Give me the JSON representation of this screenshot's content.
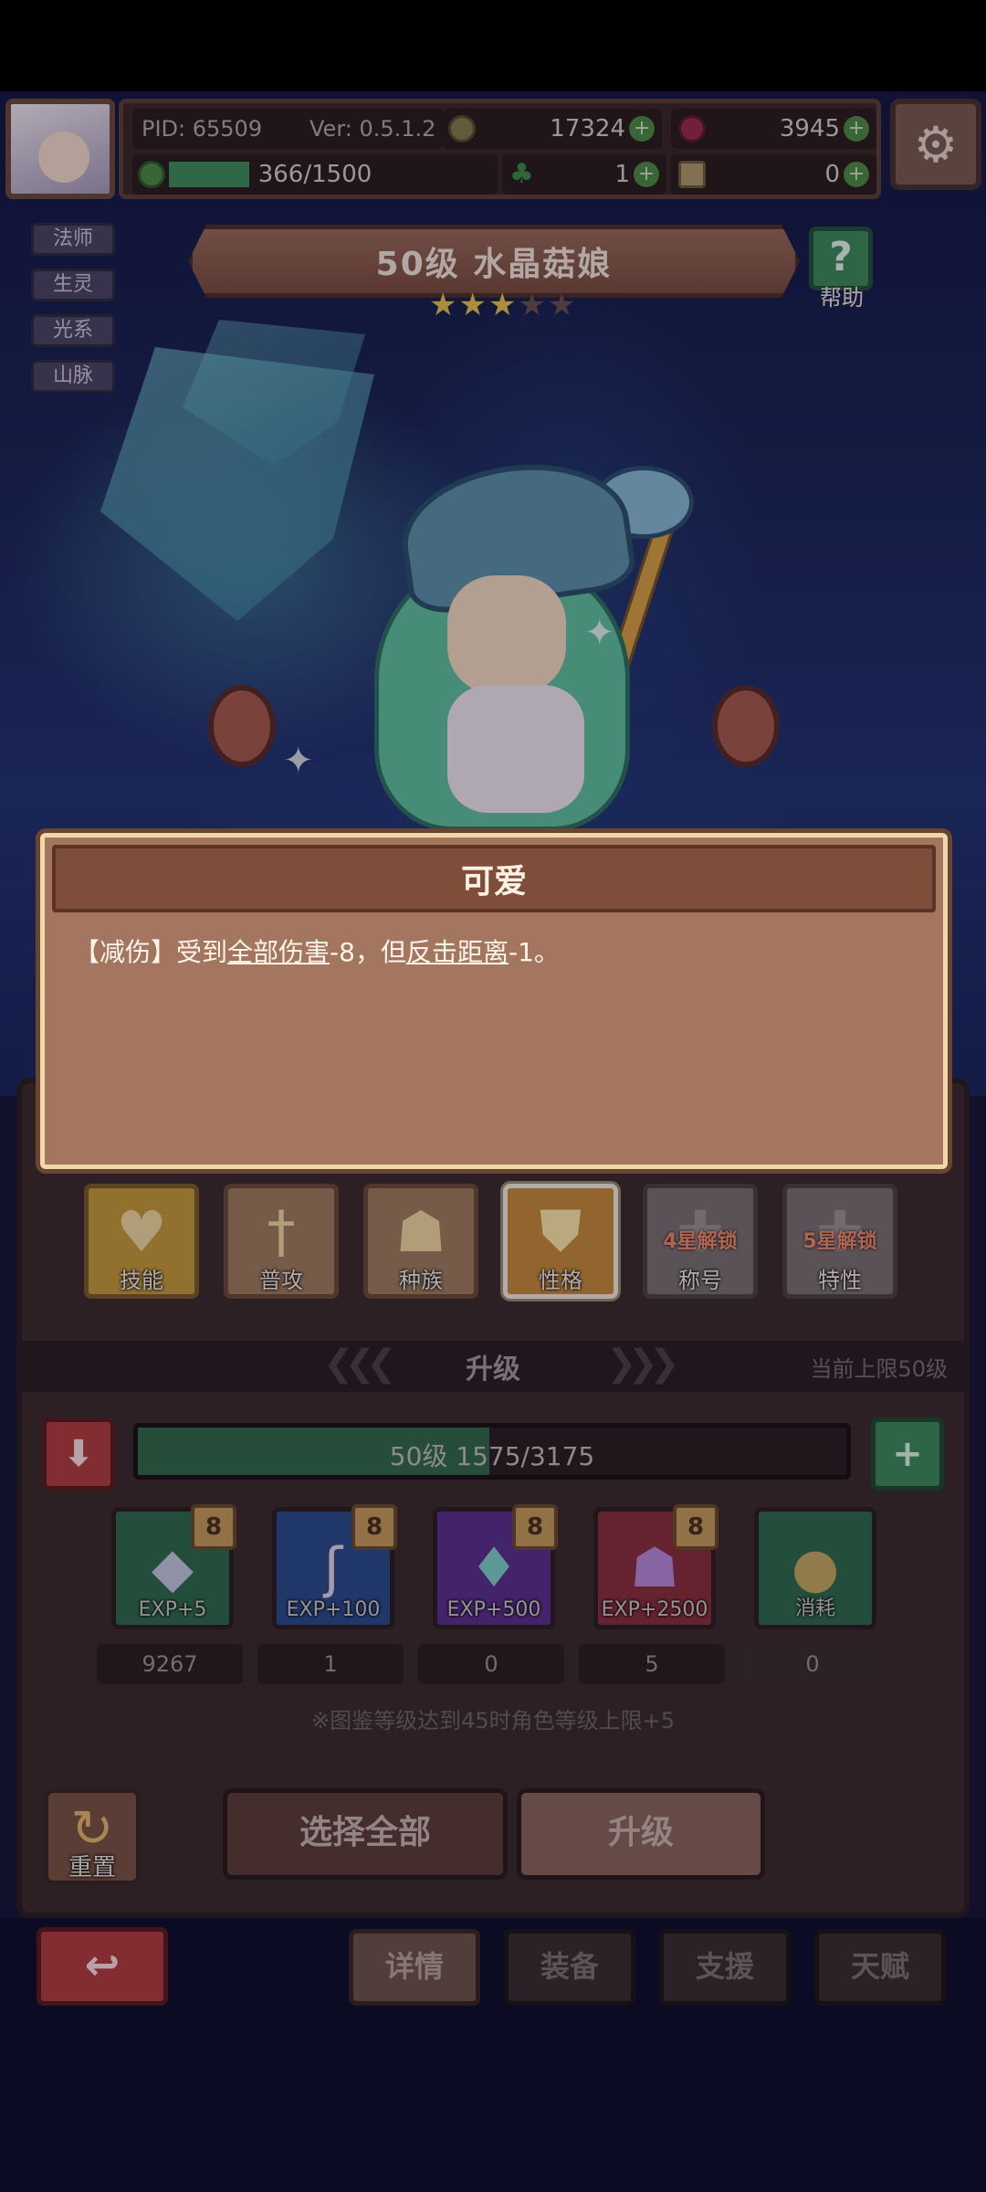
{
  "hud": {
    "pid": "PID: 65509",
    "version": "Ver: 0.5.1.2",
    "gold": "17324",
    "gems": "3945",
    "stamina": "366/1500",
    "stamina_fraction": 0.244,
    "clover": "1",
    "tickets": "0"
  },
  "tags": [
    "法师",
    "生灵",
    "光系",
    "山脉"
  ],
  "character": {
    "title": "50级 水晶菇娘",
    "stars_filled": 3,
    "stars_total": 5
  },
  "help_label": "帮助",
  "popup": {
    "title": "可爱",
    "desc_prefix": "【减伤】受到",
    "desc_kw1": "全部伤害",
    "desc_mid": "-8，但",
    "desc_kw2": "反击距离",
    "desc_suffix": "-1。"
  },
  "tabs": [
    {
      "label": "技能",
      "icon": "heart-shield-icon",
      "lock": ""
    },
    {
      "label": "普攻",
      "icon": "sword-icon",
      "lock": ""
    },
    {
      "label": "种族",
      "icon": "mushroom-icon",
      "lock": ""
    },
    {
      "label": "性格",
      "icon": "shield-icon",
      "lock": ""
    },
    {
      "label": "称号",
      "icon": "lock-icon",
      "lock": "4星解锁"
    },
    {
      "label": "特性",
      "icon": "lock-icon",
      "lock": "5星解锁"
    }
  ],
  "upgrade": {
    "title": "升级",
    "cap": "当前上限50级",
    "level_text": "50级 1575/3175",
    "progress_fraction": 0.496
  },
  "items": [
    {
      "label": "EXP+5",
      "count": "9267",
      "badge": "8",
      "icon": "gem-icon"
    },
    {
      "label": "EXP+100",
      "count": "1",
      "badge": "8",
      "icon": "bone-icon"
    },
    {
      "label": "EXP+500",
      "count": "0",
      "badge": "8",
      "icon": "crystal-icon"
    },
    {
      "label": "EXP+2500",
      "count": "5",
      "badge": "8",
      "icon": "mushroom-icon"
    },
    {
      "label": "消耗",
      "count": "0",
      "badge": "",
      "icon": "coin-icon"
    }
  ],
  "note": "※图鉴等级达到45时角色等级上限+5",
  "buttons": {
    "reset": "重置",
    "select_all": "选择全部",
    "upgrade": "升级"
  },
  "nav": [
    "详情",
    "装备",
    "支援",
    "天赋"
  ],
  "colors": {
    "accent_green": "#3f8a5a",
    "accent_red": "#b23c3c",
    "panel_brown": "#3c2a2c"
  }
}
